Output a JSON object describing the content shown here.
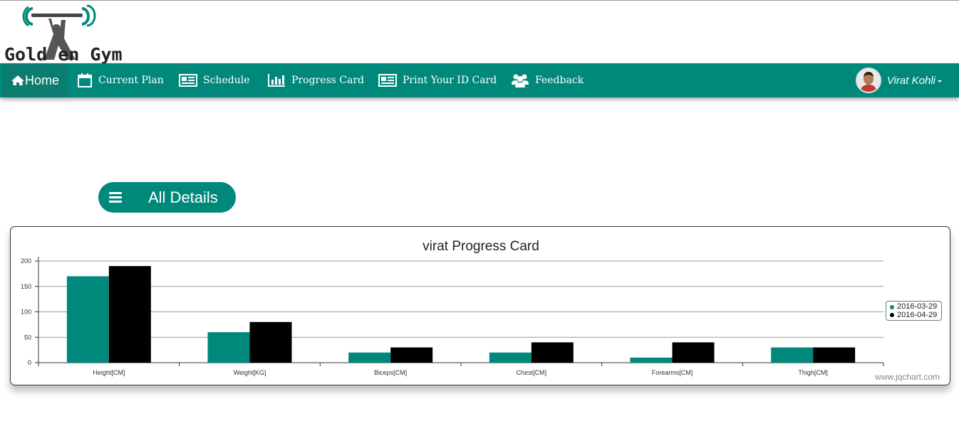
{
  "brand": {
    "name": "Golden Gym",
    "text": "Gold en Gym"
  },
  "nav": {
    "items": [
      {
        "label": "Home",
        "icon": "home-icon"
      },
      {
        "label": "Current Plan",
        "icon": "calendar-icon"
      },
      {
        "label": "Schedule",
        "icon": "newspaper-icon"
      },
      {
        "label": "Progress Card",
        "icon": "bar-chart-icon"
      },
      {
        "label": "Print Your ID Card",
        "icon": "id-card-icon"
      },
      {
        "label": "Feedback",
        "icon": "users-icon"
      }
    ],
    "user": {
      "name": "Virat Kohli"
    }
  },
  "details_button": {
    "label": "All Details"
  },
  "chart": {
    "watermark": "www.jqchart.com"
  },
  "colors": {
    "primary": "#00897b",
    "series1": "#00897b",
    "series2": "#000000"
  },
  "chart_data": {
    "type": "bar",
    "title": "virat Progress Card",
    "categories": [
      "Height[CM]",
      "Weight[KG]",
      "Biceps[CM]",
      "Chest[CM]",
      "Forearms[CM]",
      "Thigh[CM]"
    ],
    "series": [
      {
        "name": "2016-03-29",
        "color": "#00897b",
        "values": [
          170,
          60,
          20,
          20,
          10,
          30
        ]
      },
      {
        "name": "2016-04-29",
        "color": "#000000",
        "values": [
          190,
          80,
          30,
          40,
          40,
          30
        ]
      }
    ],
    "ylim": [
      0,
      200
    ],
    "yticks": [
      0,
      50,
      100,
      150,
      200
    ],
    "grid": true,
    "legend_position": "right"
  }
}
